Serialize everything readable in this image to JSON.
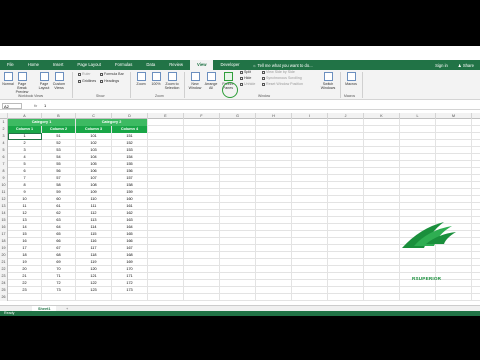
{
  "menubar": {
    "tabs": [
      "File",
      "Home",
      "Insert",
      "Page Layout",
      "Formulas",
      "Data",
      "Review",
      "View",
      "Developer"
    ],
    "active_tab": "View",
    "tell_me": "Tell me what you want to do...",
    "sign_in": "Sign in",
    "share": "Share"
  },
  "ribbon": {
    "workbook_views": {
      "normal": "Normal",
      "page_break": "Page Break Preview",
      "page_layout": "Page Layout",
      "custom_views": "Custom Views",
      "group_label": "Workbook Views"
    },
    "show": {
      "ruler": "Ruler",
      "formula_bar": "Formula Bar",
      "gridlines": "Gridlines",
      "headings": "Headings",
      "group_label": "Show"
    },
    "zoom": {
      "zoom": "Zoom",
      "hundred": "100%",
      "zoom_to_selection": "Zoom to Selection",
      "group_label": "Zoom"
    },
    "window": {
      "new_window": "New Window",
      "arrange_all": "Arrange All",
      "freeze_panes": "Freeze Panes",
      "split": "Split",
      "hide": "Hide",
      "unhide": "Unhide",
      "view_side_by_side": "View Side by Side",
      "synchronous_scrolling": "Synchronous Scrolling",
      "reset_window_position": "Reset Window Position",
      "switch_windows": "Switch Windows",
      "group_label": "Window"
    },
    "macros": {
      "macros": "Macros",
      "group_label": "Macros"
    }
  },
  "formula_bar": {
    "name_box": "A2",
    "fx": "fx",
    "value": "1"
  },
  "columns": [
    "A",
    "B",
    "C",
    "D",
    "E",
    "F",
    "G",
    "H",
    "I",
    "J",
    "K",
    "L",
    "M",
    "N",
    "O"
  ],
  "table": {
    "category_headers": [
      "Category 1",
      "Category 2"
    ],
    "column_headers": [
      "Column 1",
      "Column 2",
      "Column 3",
      "Column 4"
    ],
    "rows": [
      [
        1,
        51,
        101,
        151
      ],
      [
        2,
        52,
        102,
        152
      ],
      [
        3,
        53,
        103,
        153
      ],
      [
        4,
        54,
        104,
        154
      ],
      [
        5,
        55,
        105,
        155
      ],
      [
        6,
        56,
        106,
        156
      ],
      [
        7,
        57,
        107,
        157
      ],
      [
        8,
        58,
        108,
        158
      ],
      [
        9,
        59,
        109,
        159
      ],
      [
        10,
        60,
        110,
        160
      ],
      [
        11,
        61,
        111,
        161
      ],
      [
        12,
        62,
        112,
        162
      ],
      [
        13,
        63,
        113,
        163
      ],
      [
        14,
        64,
        114,
        164
      ],
      [
        15,
        65,
        115,
        165
      ],
      [
        16,
        66,
        116,
        166
      ],
      [
        17,
        67,
        117,
        167
      ],
      [
        18,
        68,
        118,
        168
      ],
      [
        19,
        69,
        119,
        169
      ],
      [
        20,
        70,
        120,
        170
      ],
      [
        21,
        71,
        121,
        171
      ],
      [
        22,
        72,
        122,
        172
      ],
      [
        23,
        73,
        123,
        173
      ]
    ]
  },
  "sheet_tab": "Sheet1",
  "add_sheet": "+",
  "status": "Ready",
  "watermark": {
    "text": "RSUPERIOR"
  },
  "colors": {
    "excel_green": "#217346",
    "header_green": "#2eaf55",
    "logo_green": "#1a8f3c"
  }
}
